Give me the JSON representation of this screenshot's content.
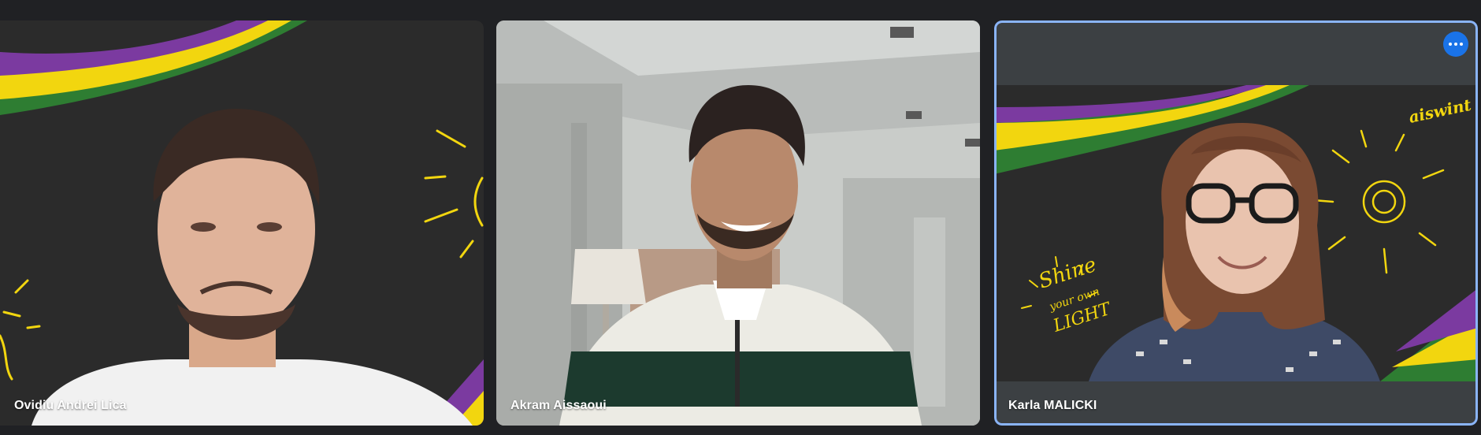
{
  "participants": [
    {
      "name": "Ovidiu Andrei Lica"
    },
    {
      "name": "Akram Aissaoui"
    },
    {
      "name": "Karla MALICKI"
    }
  ],
  "decor": {
    "logo_text": "aiswint",
    "slogan": [
      "Shine",
      "your own",
      "LIGHT"
    ]
  },
  "colors": {
    "background": "#202124",
    "pinned_border": "#8ab4f8",
    "more_button": "#1a73e8",
    "chalkboard": "#2b2b2b",
    "stripe_purple": "#7b3aa0",
    "stripe_yellow": "#f2d60f",
    "stripe_green": "#2e7d32"
  },
  "controls": {
    "more_options_icon": "more-horizontal-icon"
  }
}
